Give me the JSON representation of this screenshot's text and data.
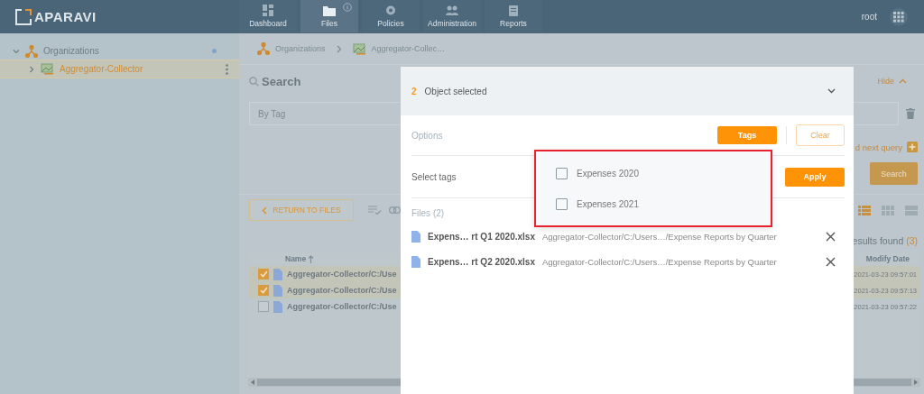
{
  "app": {
    "logo": "APARAVI",
    "user": "root"
  },
  "nav": [
    {
      "label": "Dashboard",
      "selected": false,
      "info_badge": false
    },
    {
      "label": "Files",
      "selected": true,
      "info_badge": true
    },
    {
      "label": "Policies",
      "selected": false,
      "info_badge": false
    },
    {
      "label": "Administration",
      "selected": false,
      "info_badge": false
    },
    {
      "label": "Reports",
      "selected": false,
      "info_badge": false
    }
  ],
  "sidebar": {
    "items": [
      {
        "label": "Organizations",
        "expanded": true,
        "selected": false,
        "children": [
          {
            "label": "Aggregator-Collector",
            "expanded": false,
            "selected": true
          }
        ]
      }
    ]
  },
  "breadcrumb": [
    "Organizations",
    "Aggregator-Collec…"
  ],
  "search": {
    "title": "Search",
    "hide": "Hide",
    "field_value": "By Tag",
    "next_query": "d next query",
    "button": "Search"
  },
  "toolbar": {
    "return_button": "RETURN TO FILES",
    "views": [
      {
        "selected": true
      },
      {
        "selected": false
      },
      {
        "selected": false
      }
    ]
  },
  "results": {
    "label": "esults found",
    "count": "(3)"
  },
  "table": {
    "columns": [
      "Name",
      "Modify Date"
    ],
    "rows": [
      {
        "checked": true,
        "name": "Aggregator-Collector/C:/Use",
        "modified": "2021-03-23 09:57:01"
      },
      {
        "checked": true,
        "name": "Aggregator-Collector/C:/Use",
        "modified": "2021-03-23 09:57:13"
      },
      {
        "checked": false,
        "name": "Aggregator-Collector/C:/Use",
        "modified": "2021-03-23 09:57:22"
      }
    ]
  },
  "modal": {
    "count": "2",
    "title": "Object selected",
    "options_label": "Options",
    "tags_button": "Tags",
    "clear_button": "Clear",
    "select_label": "Select tags",
    "apply_button": "Apply",
    "files_label": "Files (2)",
    "files": [
      {
        "name": "Expens… rt Q1 2020.xlsx",
        "path": "Aggregator-Collector/C:/Users…/Expense Reports by Quarter"
      },
      {
        "name": "Expens… rt Q2 2020.xlsx",
        "path": "Aggregator-Collector/C:/Users…/Expense Reports by Quarter"
      }
    ],
    "tags": [
      {
        "label": "Expenses 2020",
        "checked": false
      },
      {
        "label": "Expenses 2021",
        "checked": false
      }
    ]
  }
}
